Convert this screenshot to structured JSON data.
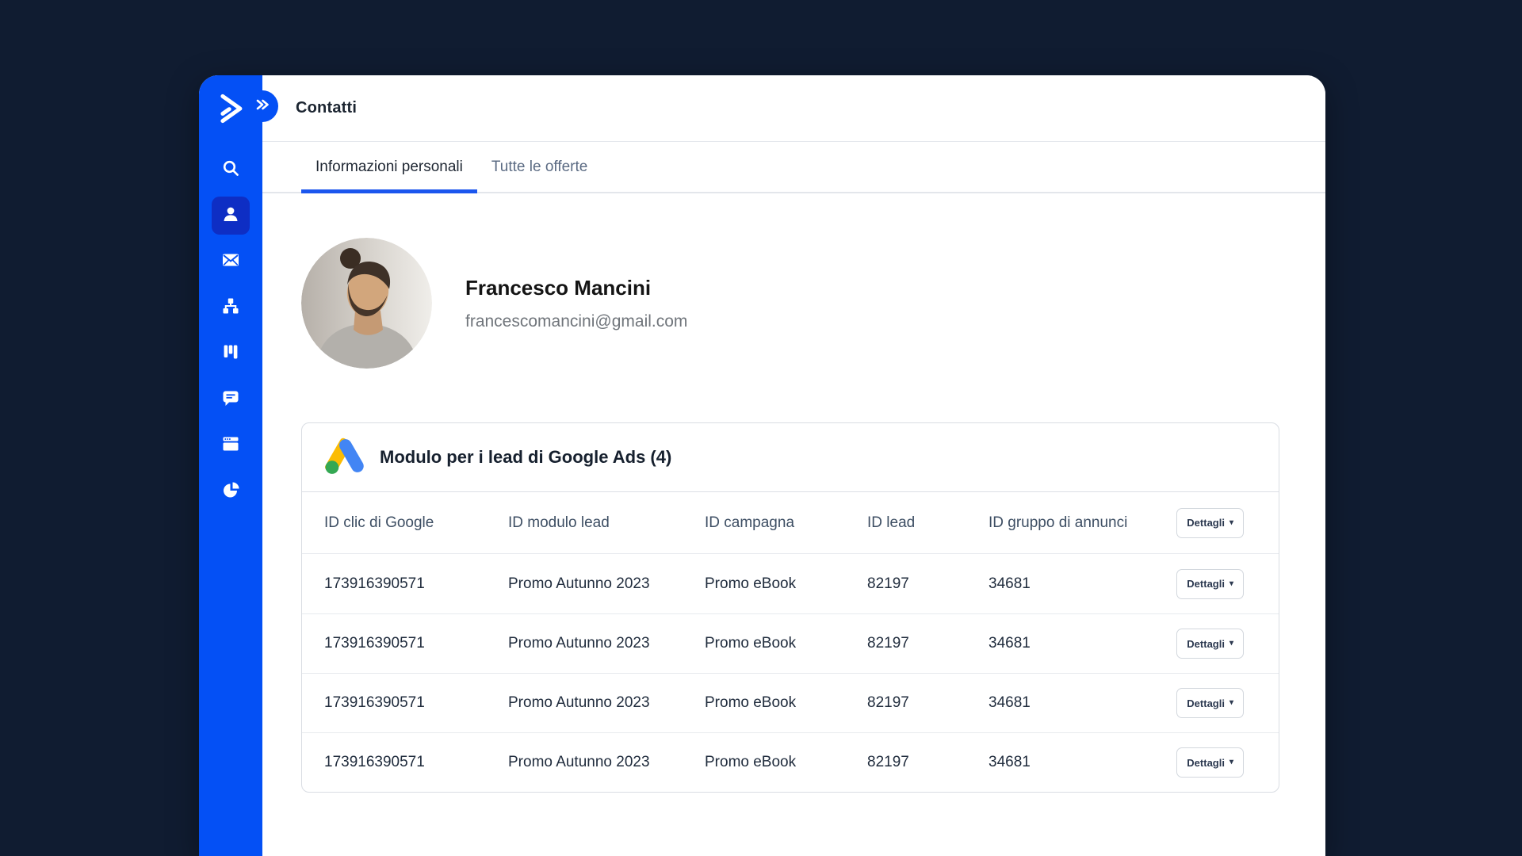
{
  "app": {
    "name": "ActiveCampaign",
    "window_title": "Contatti"
  },
  "colors": {
    "page_background": "#101c31",
    "sidebar_blue": "#0450f5",
    "sidebar_active_blue": "#0e2ec4",
    "tab_underline_blue": "#1b56ee",
    "google_blue": "#4285F4",
    "google_yellow": "#FBBC04",
    "google_green": "#34A853"
  },
  "header": {
    "title": "Contatti"
  },
  "sidebar": {
    "logo_icon": "activecampaign-chevron-logo",
    "collapse_icon": "double-chevron-right",
    "items": [
      {
        "icon": "search-icon",
        "active": false
      },
      {
        "icon": "contact-icon",
        "active": true
      },
      {
        "icon": "email-icon",
        "active": false
      },
      {
        "icon": "automation-sitemap-icon",
        "active": false
      },
      {
        "icon": "deals-kanban-icon",
        "active": false
      },
      {
        "icon": "conversations-chat-icon",
        "active": false
      },
      {
        "icon": "site-browser-icon",
        "active": false
      },
      {
        "icon": "reports-pie-icon",
        "active": false
      }
    ]
  },
  "tabs": [
    {
      "label": "Informazioni personali",
      "active": true
    },
    {
      "label": "Tutte le offerte",
      "active": false
    }
  ],
  "contact": {
    "name": "Francesco Mancini",
    "email": "francescomancini@gmail.com",
    "avatar": "photo-man-with-bun-and-beard"
  },
  "lead_table": {
    "icon": "google-ads-logo",
    "title": "Modulo per i lead di Google Ads (4)",
    "count": 4,
    "details_button_label": "Dettagli",
    "columns": [
      {
        "key": "gclid",
        "label": "ID clic di Google"
      },
      {
        "key": "lead_form",
        "label": "ID modulo lead"
      },
      {
        "key": "campaign",
        "label": "ID campagna"
      },
      {
        "key": "lead_id",
        "label": "ID lead"
      },
      {
        "key": "ad_group_id",
        "label": "ID gruppo di annunci"
      }
    ],
    "rows": [
      {
        "gclid": "173916390571",
        "lead_form": "Promo Autunno 2023",
        "campaign": "Promo eBook",
        "lead_id": "82197",
        "ad_group_id": "34681"
      },
      {
        "gclid": "173916390571",
        "lead_form": "Promo Autunno 2023",
        "campaign": "Promo eBook",
        "lead_id": "82197",
        "ad_group_id": "34681"
      },
      {
        "gclid": "173916390571",
        "lead_form": "Promo Autunno 2023",
        "campaign": "Promo eBook",
        "lead_id": "82197",
        "ad_group_id": "34681"
      },
      {
        "gclid": "173916390571",
        "lead_form": "Promo Autunno 2023",
        "campaign": "Promo eBook",
        "lead_id": "82197",
        "ad_group_id": "34681"
      }
    ]
  },
  "icons": {
    "caret_down": "▾"
  }
}
